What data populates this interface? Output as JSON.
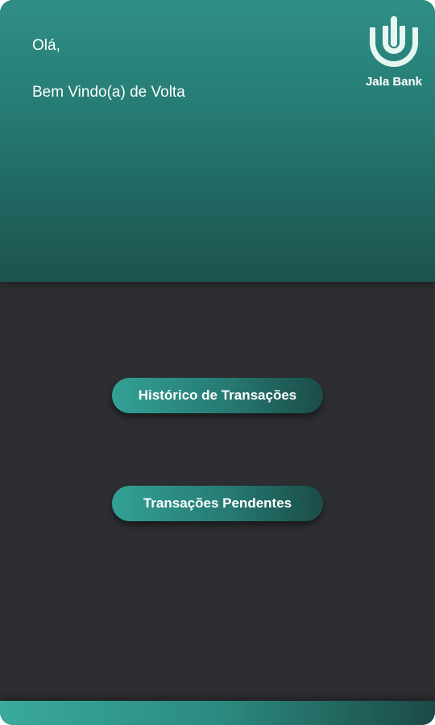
{
  "header": {
    "greeting": "Olá,",
    "welcome": "Bem Vindo(a) de Volta",
    "brand": {
      "name": "Jala Bank",
      "icon": "jala-bank-logo-icon"
    }
  },
  "actions": {
    "history_label": "Histórico de Transações",
    "pending_label": "Transações Pendentes"
  },
  "colors": {
    "header_top": "#2f8f86",
    "header_bottom": "#1c524e",
    "background": "#2d2e32",
    "button_start": "#33a195",
    "button_end": "#1b4c48",
    "logo_fill": "#e6f7f2"
  }
}
